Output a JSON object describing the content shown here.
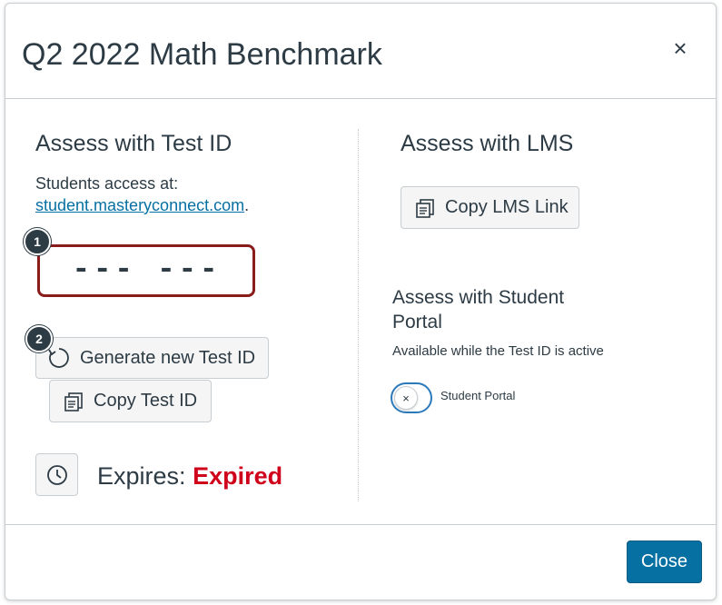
{
  "modal": {
    "title": "Q2 2022 Math Benchmark",
    "close_icon": "×"
  },
  "test_id_section": {
    "heading": "Assess with Test ID",
    "access_label": "Students access at:",
    "access_link": "student.masteryconnect.com",
    "access_link_suffix": ".",
    "code": "--- ---",
    "callout_1": "1",
    "callout_2": "2",
    "generate_label": "Generate new Test ID",
    "copy_label": "Copy Test ID",
    "expires_label": "Expires:",
    "expires_value": "Expired"
  },
  "lms_section": {
    "heading": "Assess with LMS",
    "copy_link_label": "Copy LMS Link"
  },
  "portal_section": {
    "heading_line1": "Assess with Student",
    "heading_line2": "Portal",
    "note": "Available while the Test ID is active",
    "toggle_label": "Student Portal",
    "toggle_state": "off",
    "toggle_icon": "×"
  },
  "footer": {
    "close_label": "Close"
  },
  "colors": {
    "primary": "#0770a3",
    "expired": "#d0021b",
    "code_border": "#8b1c1c",
    "text": "#2d3b45"
  }
}
